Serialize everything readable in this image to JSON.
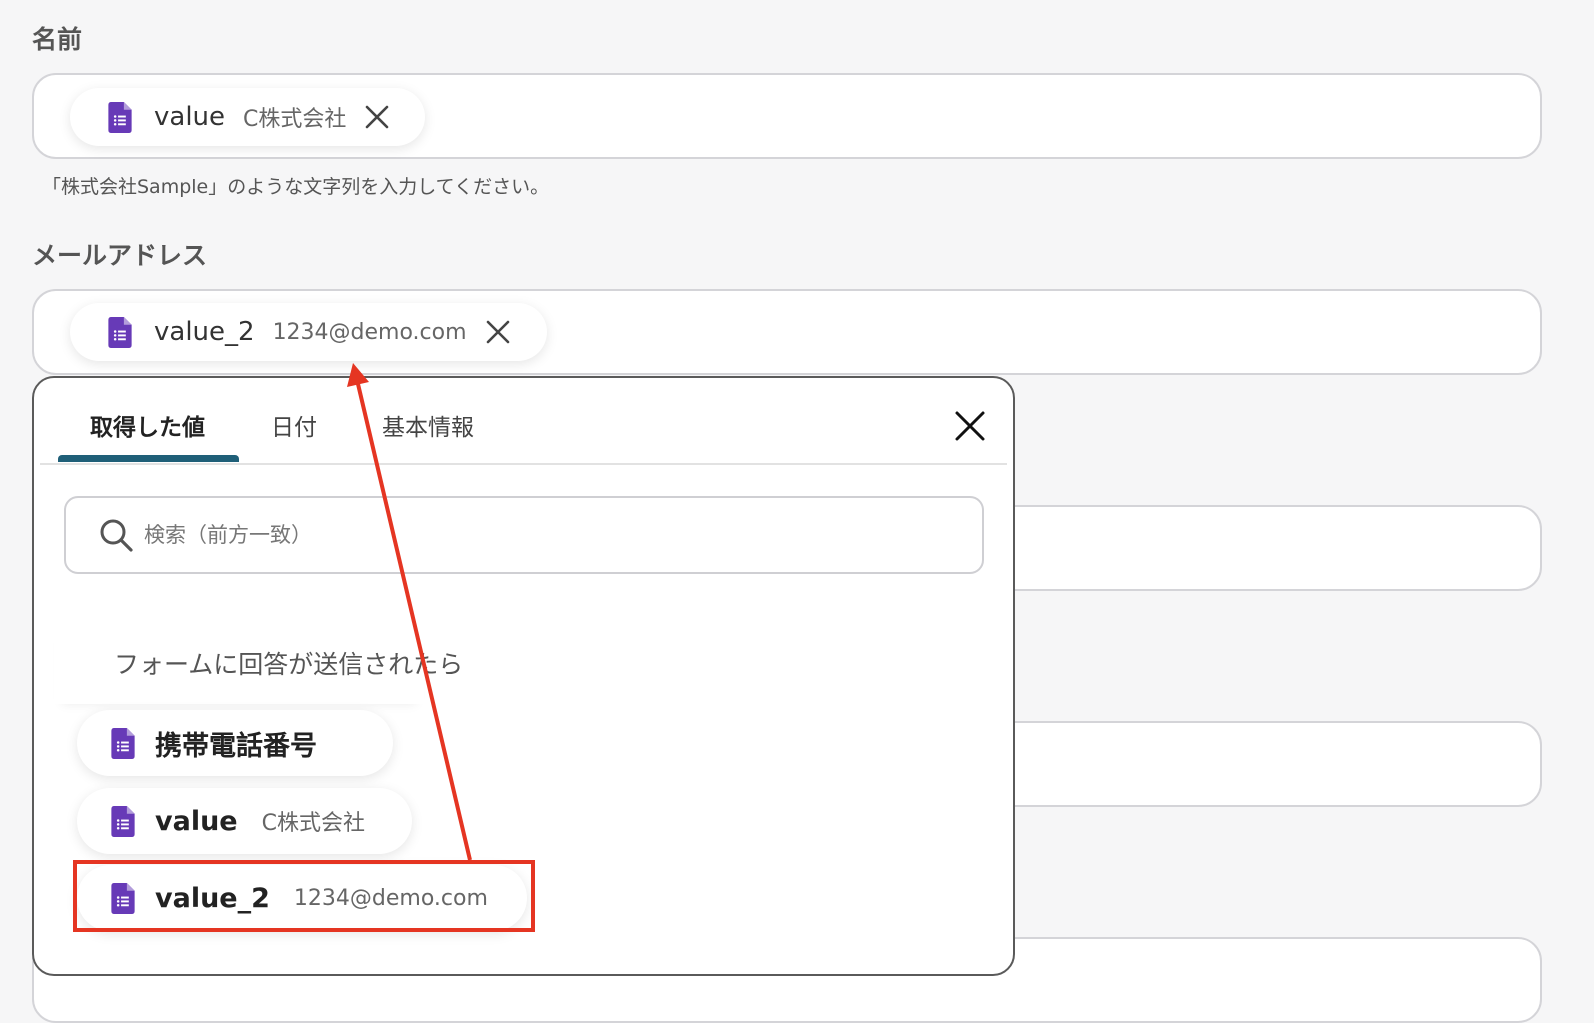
{
  "name_field": {
    "label": "名前",
    "chip": {
      "label": "value",
      "value": "C株式会社",
      "icon": "forms-doc-icon"
    },
    "hint": "「株式会社Sample」のような文字列を入力してください。"
  },
  "email_field": {
    "label": "メールアドレス",
    "chip": {
      "label": "value_2",
      "value": "1234@demo.com",
      "icon": "forms-doc-icon"
    }
  },
  "popup": {
    "tabs": [
      {
        "label": "取得した値",
        "active": true
      },
      {
        "label": "日付",
        "active": false
      },
      {
        "label": "基本情報",
        "active": false
      }
    ],
    "search_placeholder": "検索（前方一致）",
    "section": {
      "title": "フォームに回答が送信されたら",
      "expanded": true,
      "icon": "forms-doc-icon"
    },
    "items": [
      {
        "label": "携帯電話番号",
        "value": ""
      },
      {
        "label": "value",
        "value": "C株式会社"
      },
      {
        "label": "value_2",
        "value": "1234@demo.com",
        "highlighted": true
      }
    ]
  },
  "colors": {
    "forms_purple": "#673ab7",
    "tab_underline": "#1f5f78",
    "annotation_red": "#e53522"
  }
}
